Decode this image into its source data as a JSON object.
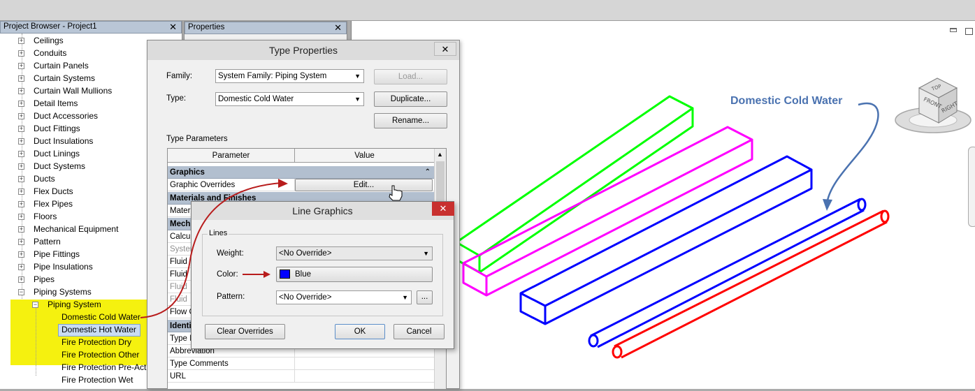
{
  "project_browser": {
    "title": "Project Browser - Project1",
    "items": [
      "Ceilings",
      "Conduits",
      "Curtain Panels",
      "Curtain Systems",
      "Curtain Wall Mullions",
      "Detail Items",
      "Duct Accessories",
      "Duct Fittings",
      "Duct Insulations",
      "Duct Linings",
      "Duct Systems",
      "Ducts",
      "Flex Ducts",
      "Flex Pipes",
      "Floors",
      "Mechanical Equipment",
      "Pattern",
      "Pipe Fittings",
      "Pipe Insulations",
      "Pipes",
      "Piping Systems"
    ],
    "subgroup": "Piping System",
    "children": [
      "Domestic Cold Water",
      "Domestic Hot Water",
      "Fire Protection Dry",
      "Fire Protection Other",
      "Fire Protection Pre-Act",
      "Fire Protection Wet"
    ]
  },
  "properties_panel": {
    "title": "Properties"
  },
  "type_properties": {
    "title": "Type Properties",
    "family_label": "Family:",
    "family_value": "System Family: Piping System",
    "type_label": "Type:",
    "type_value": "Domestic Cold Water",
    "load_button": "Load...",
    "duplicate_button": "Duplicate...",
    "rename_button": "Rename...",
    "type_parameters_label": "Type Parameters",
    "columns": [
      "Parameter",
      "Value"
    ],
    "rows": {
      "graphics": "Graphics",
      "graphic_overrides": "Graphic Overrides",
      "edit_button": "Edit...",
      "materials": "Materials and Finishes",
      "material": "Mater",
      "mechanical": "Mech",
      "calc": "Calcu",
      "system": "Syster",
      "fluid1": "Fluid",
      "fluid2": "Fluid",
      "fluid3": "Fluid",
      "fluid4": "Fluid",
      "flow": "Flow C",
      "identity": "Identi",
      "type_i": "Type I",
      "abbreviation": "Abbreviation",
      "type_comments": "Type Comments",
      "url": "URL"
    }
  },
  "line_graphics": {
    "title": "Line Graphics",
    "group_label": "Lines",
    "weight_label": "Weight:",
    "weight_value": "<No Override>",
    "color_label": "Color:",
    "color_value": "Blue",
    "color_hex": "#0000ff",
    "pattern_label": "Pattern:",
    "pattern_value": "<No Override>",
    "ellipsis_button": "...",
    "clear_overrides_button": "Clear Overrides",
    "ok_button": "OK",
    "cancel_button": "Cancel"
  },
  "viewport": {
    "annotation": "Domestic Cold Water",
    "annotation_color": "#4a72b0",
    "pipe_colors": [
      "#00ff00",
      "#ff00ff",
      "#0000ff",
      "#0000ff",
      "#ff0000"
    ],
    "viewcube_top": "TOP",
    "viewcube_front": "FRONT",
    "viewcube_right": "RIGHT"
  }
}
